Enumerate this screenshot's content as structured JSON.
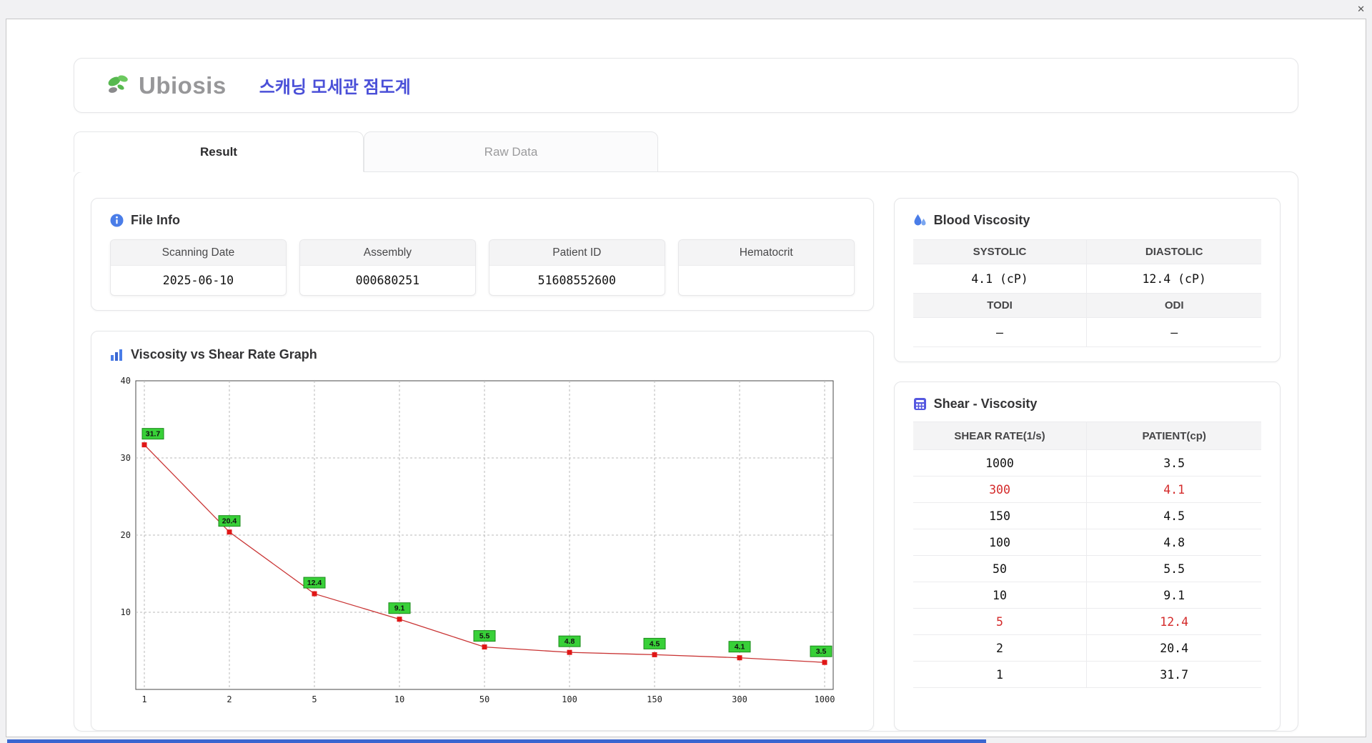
{
  "window": {
    "close_label": "✕"
  },
  "header": {
    "logo_text": "Ubiosis",
    "app_title": "스캐닝 모세관 점도계"
  },
  "tabs": {
    "result": "Result",
    "raw_data": "Raw Data"
  },
  "file_info": {
    "title": "File Info",
    "fields": [
      {
        "label": "Scanning Date",
        "value": "2025-06-10"
      },
      {
        "label": "Assembly",
        "value": "000680251"
      },
      {
        "label": "Patient ID",
        "value": "51608552600"
      },
      {
        "label": "Hematocrit",
        "value": ""
      }
    ]
  },
  "graph": {
    "title": "Viscosity vs Shear Rate Graph"
  },
  "blood_viscosity": {
    "title": "Blood Viscosity",
    "rows": [
      {
        "h": [
          "SYSTOLIC",
          "DIASTOLIC"
        ],
        "v": [
          "4.1 (cP)",
          "12.4 (cP)"
        ]
      },
      {
        "h": [
          "TODI",
          "ODI"
        ],
        "v": [
          "–",
          "–"
        ]
      }
    ]
  },
  "shear_viscosity": {
    "title": "Shear - Viscosity",
    "columns": [
      "SHEAR RATE(1/s)",
      "PATIENT(cp)"
    ],
    "rows": [
      {
        "shear_rate": "1000",
        "patient": "3.5",
        "highlight": false
      },
      {
        "shear_rate": "300",
        "patient": "4.1",
        "highlight": true
      },
      {
        "shear_rate": "150",
        "patient": "4.5",
        "highlight": false
      },
      {
        "shear_rate": "100",
        "patient": "4.8",
        "highlight": false
      },
      {
        "shear_rate": "50",
        "patient": "5.5",
        "highlight": false
      },
      {
        "shear_rate": "10",
        "patient": "9.1",
        "highlight": false
      },
      {
        "shear_rate": "5",
        "patient": "12.4",
        "highlight": true
      },
      {
        "shear_rate": "2",
        "patient": "20.4",
        "highlight": false
      },
      {
        "shear_rate": "1",
        "patient": "31.7",
        "highlight": false
      }
    ]
  },
  "chart_data": {
    "type": "line",
    "title": "Viscosity vs Shear Rate Graph",
    "x": [
      1,
      2,
      5,
      10,
      50,
      100,
      150,
      300,
      1000
    ],
    "x_tick_labels": [
      "1",
      "2",
      "5",
      "10",
      "50",
      "100",
      "150",
      "300",
      "1000"
    ],
    "values": [
      31.7,
      20.4,
      12.4,
      9.1,
      5.5,
      4.8,
      4.5,
      4.1,
      3.5
    ],
    "ylim": [
      0,
      40
    ],
    "y_ticks": [
      10,
      20,
      30,
      40
    ],
    "x_scale": "categorical",
    "grid": true,
    "legend": false,
    "line_color": "#c93434",
    "marker_color": "#e01616",
    "point_label_bg": "#38d038",
    "point_label_border": "#1b8a1b"
  },
  "colors": {
    "accent_blue": "#4a7de8",
    "accent_purple": "#5558e0",
    "highlight_red": "#d42a2a",
    "bottom_bar_blue": "#3a66d0"
  }
}
